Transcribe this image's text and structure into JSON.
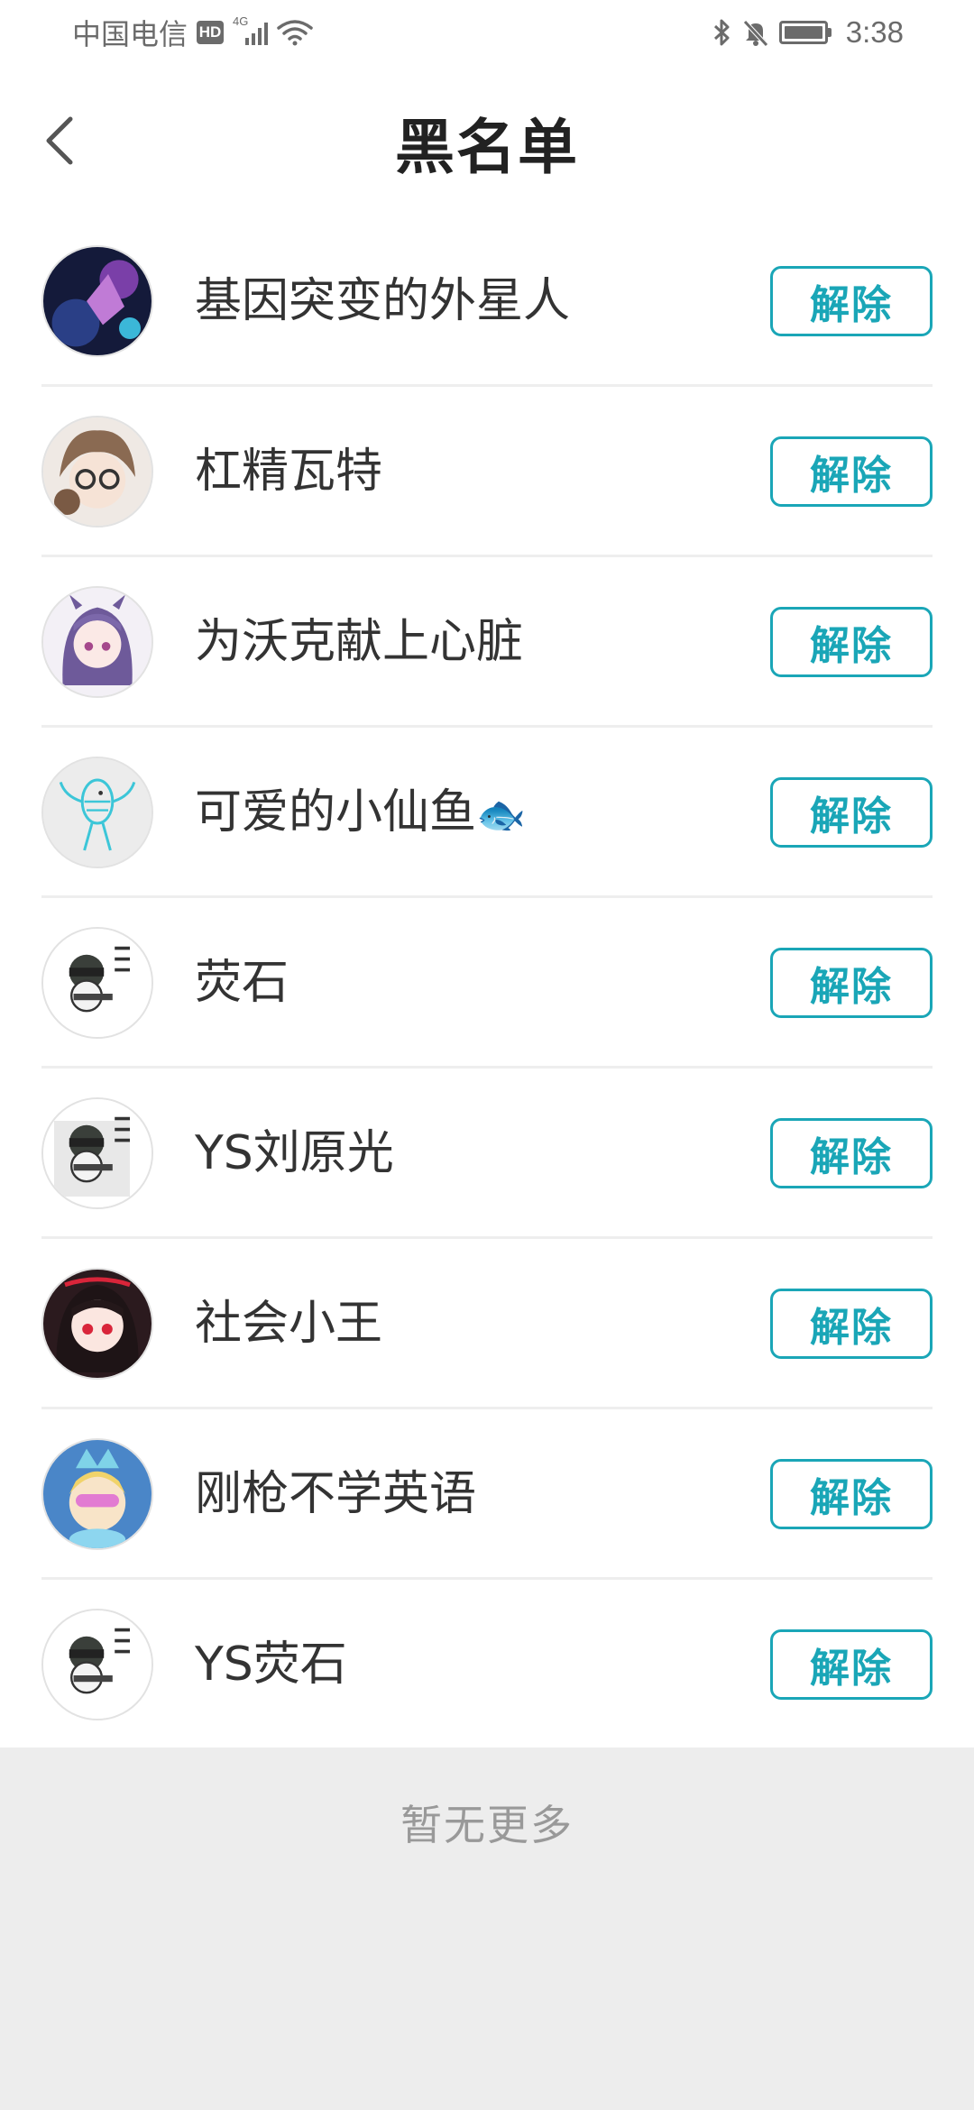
{
  "status_bar": {
    "carrier": "中国电信",
    "hd": "HD",
    "network": "4G",
    "time": "3:38",
    "icons": [
      "bluetooth-icon",
      "mute-bell-icon",
      "battery-icon"
    ]
  },
  "header": {
    "title": "黑名单",
    "back_icon": "chevron-left-icon"
  },
  "accent_color": "#1aa6b7",
  "list": {
    "items": [
      {
        "name": "基因突变的外星人",
        "button": "解除"
      },
      {
        "name": "杠精瓦特",
        "button": "解除"
      },
      {
        "name": "为沃克献上心脏",
        "button": "解除"
      },
      {
        "name": "可爱的小仙鱼",
        "emoji": "🐟",
        "button": "解除"
      },
      {
        "name": "荧石",
        "button": "解除"
      },
      {
        "name": "YS刘原光",
        "button": "解除"
      },
      {
        "name": "社会小王",
        "button": "解除"
      },
      {
        "name": "刚枪不学英语",
        "button": "解除"
      },
      {
        "name": "YS荧石",
        "button": "解除"
      }
    ]
  },
  "footer": {
    "no_more": "暂无更多"
  }
}
